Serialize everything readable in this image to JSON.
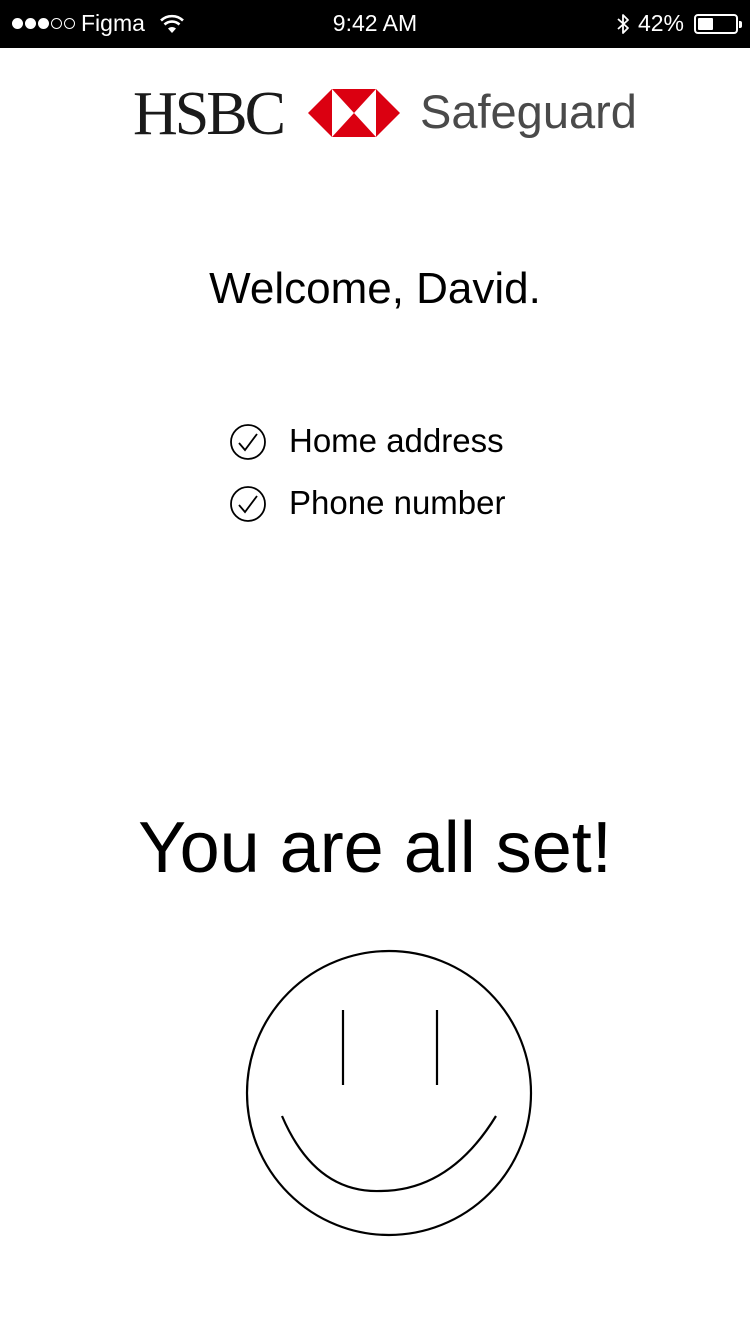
{
  "status_bar": {
    "carrier": "Figma",
    "time": "9:42 AM",
    "battery_percent": "42%",
    "battery_level": 0.42,
    "signal_bars_filled": 3,
    "signal_bars_total": 5
  },
  "header": {
    "brand": "HSBC",
    "app_name": "Safeguard",
    "brand_color": "#db0011"
  },
  "welcome": "Welcome, David.",
  "checklist": [
    {
      "label": "Home address",
      "checked": true
    },
    {
      "label": "Phone number",
      "checked": true
    }
  ],
  "completion_title": "You are all set!",
  "icons": {
    "logo": "hsbc-hexagon-icon",
    "check": "check-circle-icon",
    "smiley": "smiley-face-icon"
  }
}
